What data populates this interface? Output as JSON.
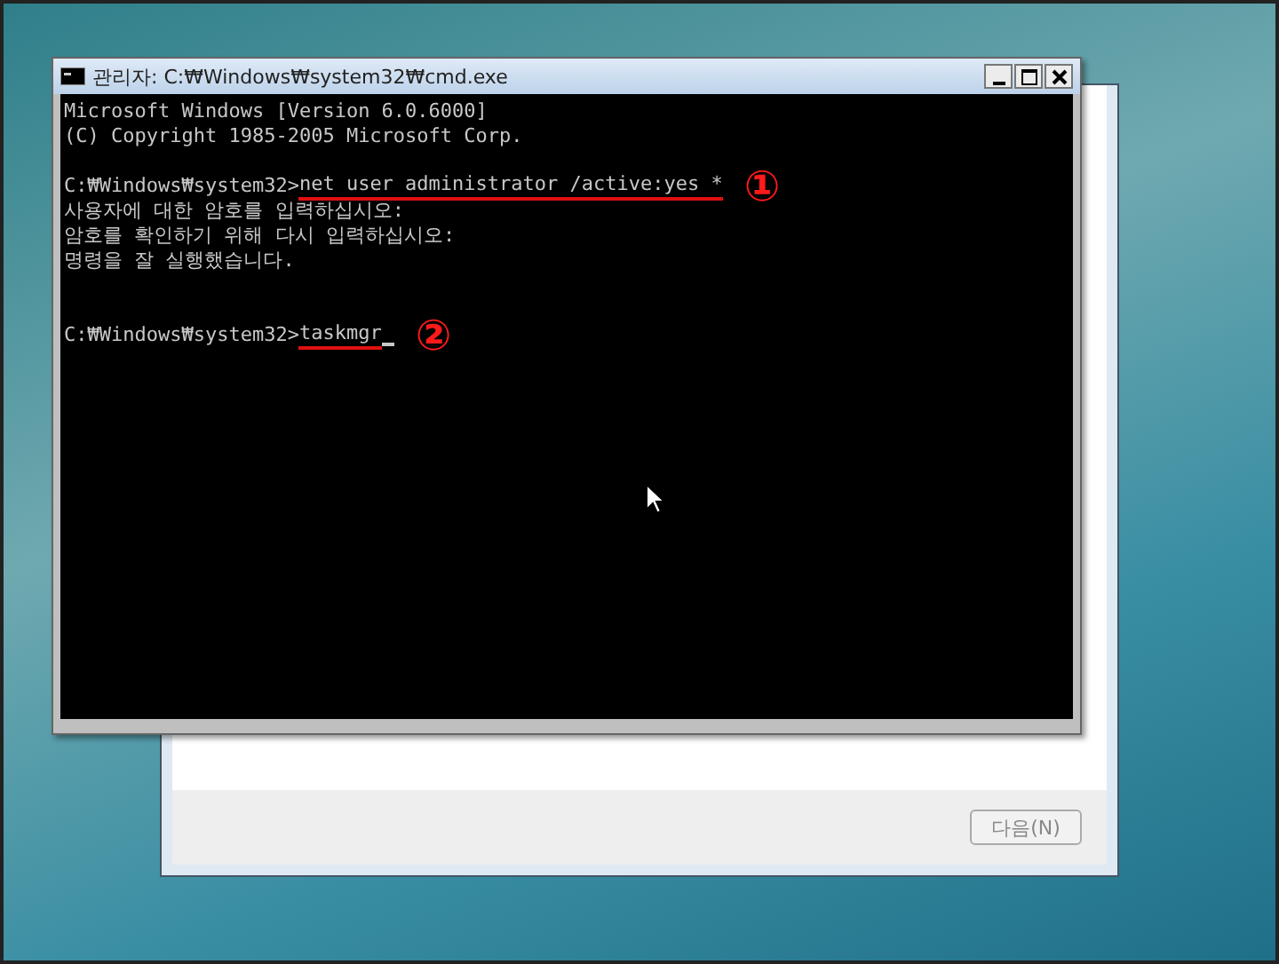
{
  "setup_window": {
    "next_button": {
      "label": "다음(N)",
      "disabled": true
    }
  },
  "console_window": {
    "title": "관리자: C:₩Windows₩system32₩cmd.exe",
    "lines": [
      {
        "kind": "text",
        "text": "Microsoft Windows [Version 6.0.6000]"
      },
      {
        "kind": "text",
        "text": "(C) Copyright 1985-2005 Microsoft Corp."
      },
      {
        "kind": "blank"
      },
      {
        "kind": "command",
        "prompt": "C:₩Windows₩system32>",
        "command": "net user administrator /active:yes *",
        "marker": "①",
        "cursor": false
      },
      {
        "kind": "text",
        "text": "사용자에 대한 암호를 입력하십시오:"
      },
      {
        "kind": "text",
        "text": "암호를 확인하기 위해 다시 입력하십시오:"
      },
      {
        "kind": "text",
        "text": "명령을 잘 실행했습니다."
      },
      {
        "kind": "blank"
      },
      {
        "kind": "blank"
      },
      {
        "kind": "command",
        "prompt": "C:₩Windows₩system32>",
        "command": "taskmgr",
        "marker": "②",
        "cursor": true
      }
    ]
  }
}
